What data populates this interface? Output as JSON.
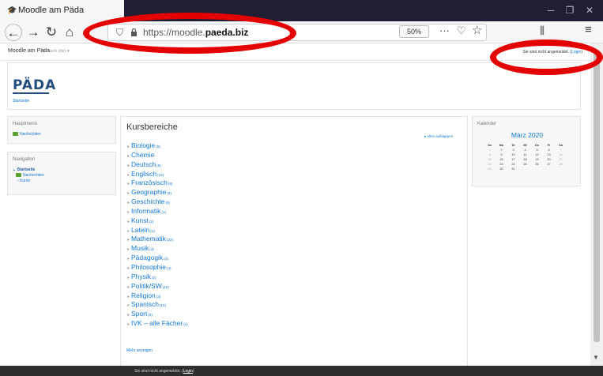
{
  "browser": {
    "tab_title": "Moodle am Päda",
    "url_prefix": "https://moodle.",
    "url_domain": "paeda.biz",
    "zoom": "50%",
    "win_minimize": "─",
    "win_maximize": "❐",
    "win_close": "✕",
    "back_glyph": "←",
    "forward_glyph": "→",
    "reload_glyph": "↻",
    "home_glyph": "⌂",
    "shield_glyph": "⛉",
    "more_glyph": "···",
    "pocket_glyph": "♡",
    "star_glyph": "☆",
    "library_glyph": "⫼",
    "menu_glyph": "≡"
  },
  "moodle_nav": {
    "site_name": "Moodle am Päda",
    "language": "Deutsch (de) ▾",
    "login_text": "Sie sind nicht angemeldet. (",
    "login_link": "Login",
    "login_end": ")"
  },
  "header": {
    "logo": "PÄDA",
    "breadcrumb": "Startseite"
  },
  "blocks": {
    "main_menu_title": "Hauptmenü",
    "main_menu_item": "Nachrichten",
    "navigation_title": "Navigation",
    "nav_home": "Startseite",
    "nav_news": "Nachrichten",
    "nav_courses": "Kurse"
  },
  "content": {
    "title": "Kursbereiche",
    "expand_all": "Alles aufklappen",
    "more_link": "Mehr anzeigen",
    "categories": [
      {
        "name": "Biologie",
        "count": "(8)"
      },
      {
        "name": "Chemie",
        "count": ""
      },
      {
        "name": "Deutsch",
        "count": "(8)"
      },
      {
        "name": "Englisch",
        "count": "(10)"
      },
      {
        "name": "Französisch",
        "count": "(8)"
      },
      {
        "name": "Geographie",
        "count": "(5)"
      },
      {
        "name": "Geschichte",
        "count": "(6)"
      },
      {
        "name": "Informatik",
        "count": "(1)"
      },
      {
        "name": "Kunst",
        "count": "(2)"
      },
      {
        "name": "Latein",
        "count": "(1)"
      },
      {
        "name": "Mathematik",
        "count": "(22)"
      },
      {
        "name": "Musik",
        "count": "(3)"
      },
      {
        "name": "Pädagogik",
        "count": "(4)"
      },
      {
        "name": "Philosophie",
        "count": "(4)"
      },
      {
        "name": "Physik",
        "count": "(2)"
      },
      {
        "name": "Politik/SW",
        "count": "(10)"
      },
      {
        "name": "Religion",
        "count": "(3)"
      },
      {
        "name": "Spanisch",
        "count": "(10)"
      },
      {
        "name": "Sport",
        "count": "(6)"
      },
      {
        "name": "IVK – alle Fächer",
        "count": "(2)"
      }
    ]
  },
  "calendar": {
    "title": "Kalender",
    "month": "März 2020",
    "weekdays": [
      "So",
      "Mo",
      "Di",
      "Mi",
      "Do",
      "Fr",
      "Sa"
    ],
    "weeks": [
      [
        "1",
        "2",
        "3",
        "4",
        "5",
        "6",
        "7"
      ],
      [
        "8",
        "9",
        "10",
        "11",
        "12",
        "13",
        "14"
      ],
      [
        "15",
        "16",
        "17",
        "18",
        "19",
        "20",
        "21"
      ],
      [
        "22",
        "23",
        "24",
        "25",
        "26",
        "27",
        "28"
      ],
      [
        "29",
        "30",
        "31",
        "",
        "",
        "",
        ""
      ]
    ]
  },
  "footer": {
    "text": "Sie sind nicht angemeldet. (",
    "link": "Login",
    "end": ")"
  },
  "colors": {
    "link": "#1177d1",
    "titlebar": "#1f1e33",
    "annotation": "#e40000"
  }
}
